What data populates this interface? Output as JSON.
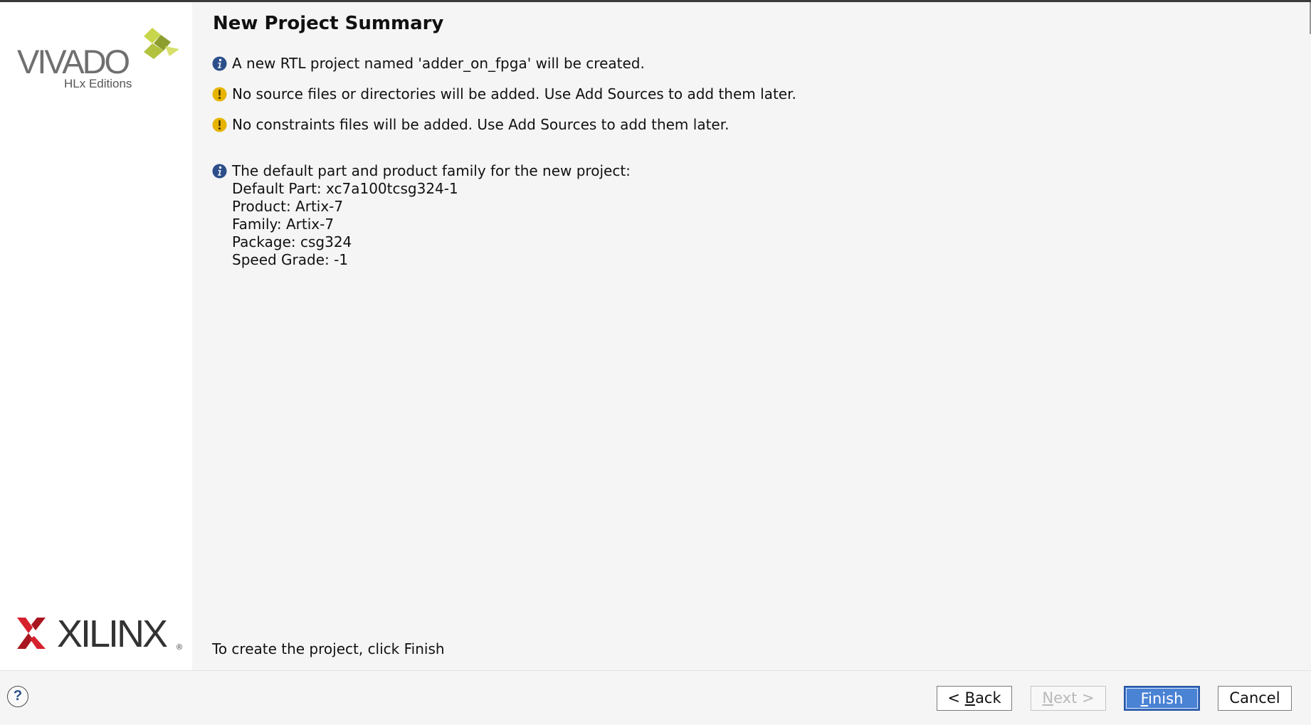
{
  "window": {
    "title": "New Project Summary"
  },
  "sidebar": {
    "vivado_wordmark": "VIVADO",
    "vivado_edition": "HLx Editions",
    "xilinx_wordmark": "XILINX",
    "xilinx_registered": "®"
  },
  "messages": [
    {
      "type": "info",
      "icon": "info-icon",
      "lines": [
        "A new RTL project named 'adder_on_fpga' will be created."
      ]
    },
    {
      "type": "warning",
      "icon": "warning-icon",
      "lines": [
        "No source files or directories will be added. Use Add Sources to add them later."
      ]
    },
    {
      "type": "warning",
      "icon": "warning-icon",
      "lines": [
        "No constraints files will be added. Use Add Sources to add them later."
      ]
    },
    {
      "type": "info",
      "icon": "info-icon",
      "lines": [
        "The default part and product family for the new project:",
        "Default Part: xc7a100tcsg324-1",
        "Product: Artix-7",
        "Family: Artix-7",
        "Package: csg324",
        "Speed Grade: -1"
      ]
    }
  ],
  "finish_hint": "To create the project, click Finish",
  "footer": {
    "help_label": "?",
    "back": {
      "prefix": "< ",
      "mnemonic": "B",
      "rest": "ack"
    },
    "next": {
      "mnemonic": "N",
      "rest": "ext >"
    },
    "finish": {
      "mnemonic": "F",
      "rest": "inish"
    },
    "cancel": "Cancel"
  },
  "colors": {
    "info_icon": "#2c4f8a",
    "warning_icon": "#e6b400",
    "finish_button": "#4a82d4",
    "vivado_leaf_light": "#c8d64b",
    "vivado_leaf_dark": "#8d9e2f",
    "xilinx_red": "#d6202e"
  }
}
